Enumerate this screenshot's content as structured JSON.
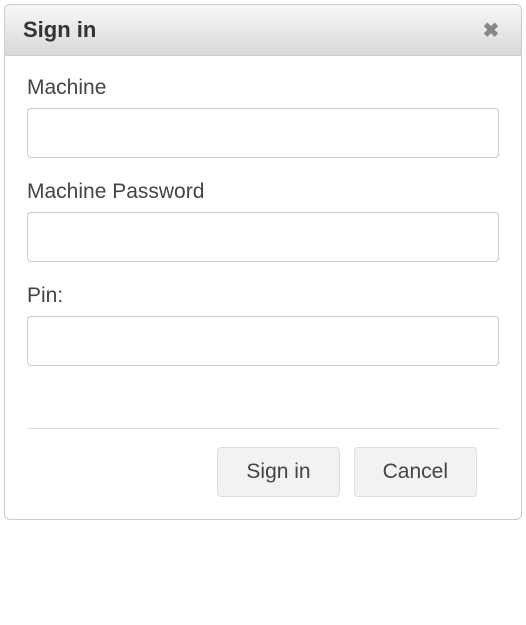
{
  "dialog": {
    "title": "Sign in",
    "fields": {
      "machine": {
        "label": "Machine",
        "value": ""
      },
      "password": {
        "label": "Machine Password",
        "value": ""
      },
      "pin": {
        "label": "Pin:",
        "value": ""
      }
    },
    "buttons": {
      "signin": "Sign in",
      "cancel": "Cancel"
    }
  }
}
